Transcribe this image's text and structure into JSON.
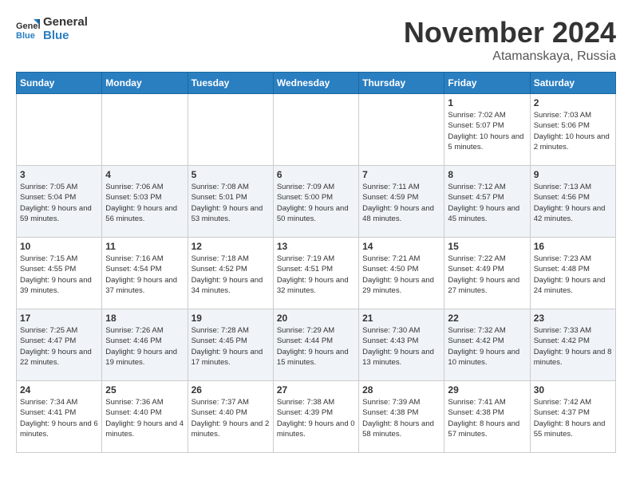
{
  "logo": {
    "general": "General",
    "blue": "Blue"
  },
  "title": "November 2024",
  "location": "Atamanskaya, Russia",
  "weekdays": [
    "Sunday",
    "Monday",
    "Tuesday",
    "Wednesday",
    "Thursday",
    "Friday",
    "Saturday"
  ],
  "weeks": [
    [
      {
        "day": "",
        "sunrise": "",
        "sunset": "",
        "daylight": ""
      },
      {
        "day": "",
        "sunrise": "",
        "sunset": "",
        "daylight": ""
      },
      {
        "day": "",
        "sunrise": "",
        "sunset": "",
        "daylight": ""
      },
      {
        "day": "",
        "sunrise": "",
        "sunset": "",
        "daylight": ""
      },
      {
        "day": "",
        "sunrise": "",
        "sunset": "",
        "daylight": ""
      },
      {
        "day": "1",
        "sunrise": "Sunrise: 7:02 AM",
        "sunset": "Sunset: 5:07 PM",
        "daylight": "Daylight: 10 hours and 5 minutes."
      },
      {
        "day": "2",
        "sunrise": "Sunrise: 7:03 AM",
        "sunset": "Sunset: 5:06 PM",
        "daylight": "Daylight: 10 hours and 2 minutes."
      }
    ],
    [
      {
        "day": "3",
        "sunrise": "Sunrise: 7:05 AM",
        "sunset": "Sunset: 5:04 PM",
        "daylight": "Daylight: 9 hours and 59 minutes."
      },
      {
        "day": "4",
        "sunrise": "Sunrise: 7:06 AM",
        "sunset": "Sunset: 5:03 PM",
        "daylight": "Daylight: 9 hours and 56 minutes."
      },
      {
        "day": "5",
        "sunrise": "Sunrise: 7:08 AM",
        "sunset": "Sunset: 5:01 PM",
        "daylight": "Daylight: 9 hours and 53 minutes."
      },
      {
        "day": "6",
        "sunrise": "Sunrise: 7:09 AM",
        "sunset": "Sunset: 5:00 PM",
        "daylight": "Daylight: 9 hours and 50 minutes."
      },
      {
        "day": "7",
        "sunrise": "Sunrise: 7:11 AM",
        "sunset": "Sunset: 4:59 PM",
        "daylight": "Daylight: 9 hours and 48 minutes."
      },
      {
        "day": "8",
        "sunrise": "Sunrise: 7:12 AM",
        "sunset": "Sunset: 4:57 PM",
        "daylight": "Daylight: 9 hours and 45 minutes."
      },
      {
        "day": "9",
        "sunrise": "Sunrise: 7:13 AM",
        "sunset": "Sunset: 4:56 PM",
        "daylight": "Daylight: 9 hours and 42 minutes."
      }
    ],
    [
      {
        "day": "10",
        "sunrise": "Sunrise: 7:15 AM",
        "sunset": "Sunset: 4:55 PM",
        "daylight": "Daylight: 9 hours and 39 minutes."
      },
      {
        "day": "11",
        "sunrise": "Sunrise: 7:16 AM",
        "sunset": "Sunset: 4:54 PM",
        "daylight": "Daylight: 9 hours and 37 minutes."
      },
      {
        "day": "12",
        "sunrise": "Sunrise: 7:18 AM",
        "sunset": "Sunset: 4:52 PM",
        "daylight": "Daylight: 9 hours and 34 minutes."
      },
      {
        "day": "13",
        "sunrise": "Sunrise: 7:19 AM",
        "sunset": "Sunset: 4:51 PM",
        "daylight": "Daylight: 9 hours and 32 minutes."
      },
      {
        "day": "14",
        "sunrise": "Sunrise: 7:21 AM",
        "sunset": "Sunset: 4:50 PM",
        "daylight": "Daylight: 9 hours and 29 minutes."
      },
      {
        "day": "15",
        "sunrise": "Sunrise: 7:22 AM",
        "sunset": "Sunset: 4:49 PM",
        "daylight": "Daylight: 9 hours and 27 minutes."
      },
      {
        "day": "16",
        "sunrise": "Sunrise: 7:23 AM",
        "sunset": "Sunset: 4:48 PM",
        "daylight": "Daylight: 9 hours and 24 minutes."
      }
    ],
    [
      {
        "day": "17",
        "sunrise": "Sunrise: 7:25 AM",
        "sunset": "Sunset: 4:47 PM",
        "daylight": "Daylight: 9 hours and 22 minutes."
      },
      {
        "day": "18",
        "sunrise": "Sunrise: 7:26 AM",
        "sunset": "Sunset: 4:46 PM",
        "daylight": "Daylight: 9 hours and 19 minutes."
      },
      {
        "day": "19",
        "sunrise": "Sunrise: 7:28 AM",
        "sunset": "Sunset: 4:45 PM",
        "daylight": "Daylight: 9 hours and 17 minutes."
      },
      {
        "day": "20",
        "sunrise": "Sunrise: 7:29 AM",
        "sunset": "Sunset: 4:44 PM",
        "daylight": "Daylight: 9 hours and 15 minutes."
      },
      {
        "day": "21",
        "sunrise": "Sunrise: 7:30 AM",
        "sunset": "Sunset: 4:43 PM",
        "daylight": "Daylight: 9 hours and 13 minutes."
      },
      {
        "day": "22",
        "sunrise": "Sunrise: 7:32 AM",
        "sunset": "Sunset: 4:42 PM",
        "daylight": "Daylight: 9 hours and 10 minutes."
      },
      {
        "day": "23",
        "sunrise": "Sunrise: 7:33 AM",
        "sunset": "Sunset: 4:42 PM",
        "daylight": "Daylight: 9 hours and 8 minutes."
      }
    ],
    [
      {
        "day": "24",
        "sunrise": "Sunrise: 7:34 AM",
        "sunset": "Sunset: 4:41 PM",
        "daylight": "Daylight: 9 hours and 6 minutes."
      },
      {
        "day": "25",
        "sunrise": "Sunrise: 7:36 AM",
        "sunset": "Sunset: 4:40 PM",
        "daylight": "Daylight: 9 hours and 4 minutes."
      },
      {
        "day": "26",
        "sunrise": "Sunrise: 7:37 AM",
        "sunset": "Sunset: 4:40 PM",
        "daylight": "Daylight: 9 hours and 2 minutes."
      },
      {
        "day": "27",
        "sunrise": "Sunrise: 7:38 AM",
        "sunset": "Sunset: 4:39 PM",
        "daylight": "Daylight: 9 hours and 0 minutes."
      },
      {
        "day": "28",
        "sunrise": "Sunrise: 7:39 AM",
        "sunset": "Sunset: 4:38 PM",
        "daylight": "Daylight: 8 hours and 58 minutes."
      },
      {
        "day": "29",
        "sunrise": "Sunrise: 7:41 AM",
        "sunset": "Sunset: 4:38 PM",
        "daylight": "Daylight: 8 hours and 57 minutes."
      },
      {
        "day": "30",
        "sunrise": "Sunrise: 7:42 AM",
        "sunset": "Sunset: 4:37 PM",
        "daylight": "Daylight: 8 hours and 55 minutes."
      }
    ]
  ]
}
